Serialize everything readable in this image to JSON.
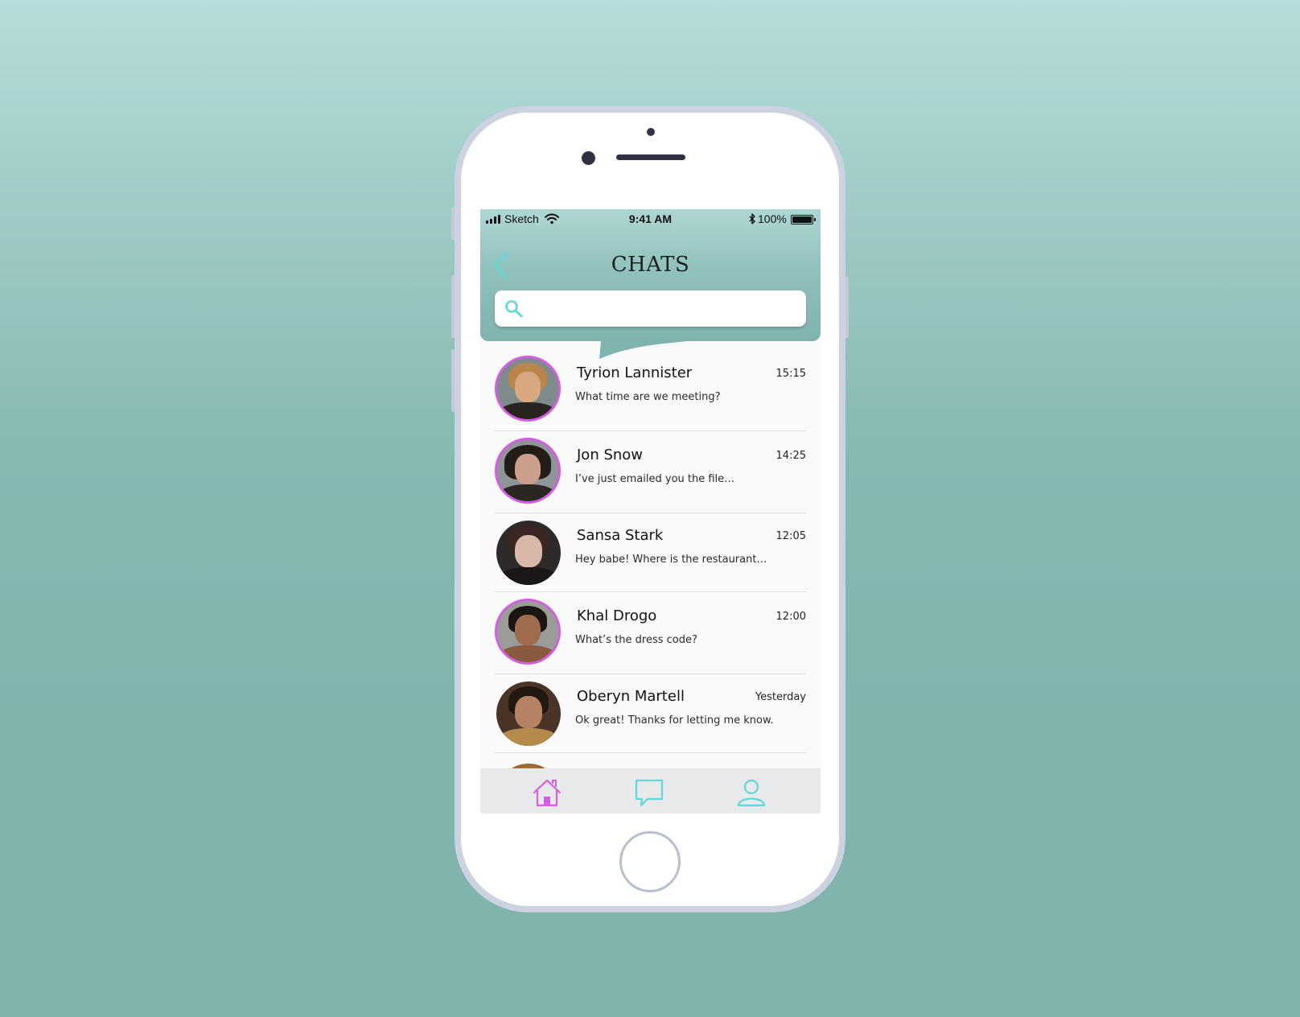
{
  "status_bar": {
    "carrier": "Sketch",
    "time": "9:41 AM",
    "battery": "100%"
  },
  "header": {
    "title": "CHATS",
    "back_icon": "chevron-left-icon"
  },
  "search": {
    "placeholder": "",
    "value": "",
    "icon": "search-icon"
  },
  "chats": [
    {
      "name": "Tyrion Lannister",
      "time": "15:15",
      "preview": "What time are we meeting?",
      "online": true
    },
    {
      "name": "Jon Snow",
      "time": "14:25",
      "preview": "I’ve just emailed you the file…",
      "online": true
    },
    {
      "name": "Sansa Stark",
      "time": "12:05",
      "preview": "Hey babe! Where is the restaurant…",
      "online": false
    },
    {
      "name": "Khal Drogo",
      "time": "12:00",
      "preview": "What’s the dress code?",
      "online": true
    },
    {
      "name": "Oberyn Martell",
      "time": "Yesterday",
      "preview": "Ok great! Thanks for letting me know.",
      "online": false
    }
  ],
  "tabs": [
    {
      "id": "home",
      "icon": "home-icon",
      "active": true
    },
    {
      "id": "chats",
      "icon": "chat-bubble-icon",
      "active": false
    },
    {
      "id": "profile",
      "icon": "user-icon",
      "active": false
    }
  ],
  "colors": {
    "accent_pink": "#d35fe0",
    "accent_teal": "#5fd8d6",
    "header_teal": "#7fb3ad",
    "background_teal": "#80b3ac"
  }
}
